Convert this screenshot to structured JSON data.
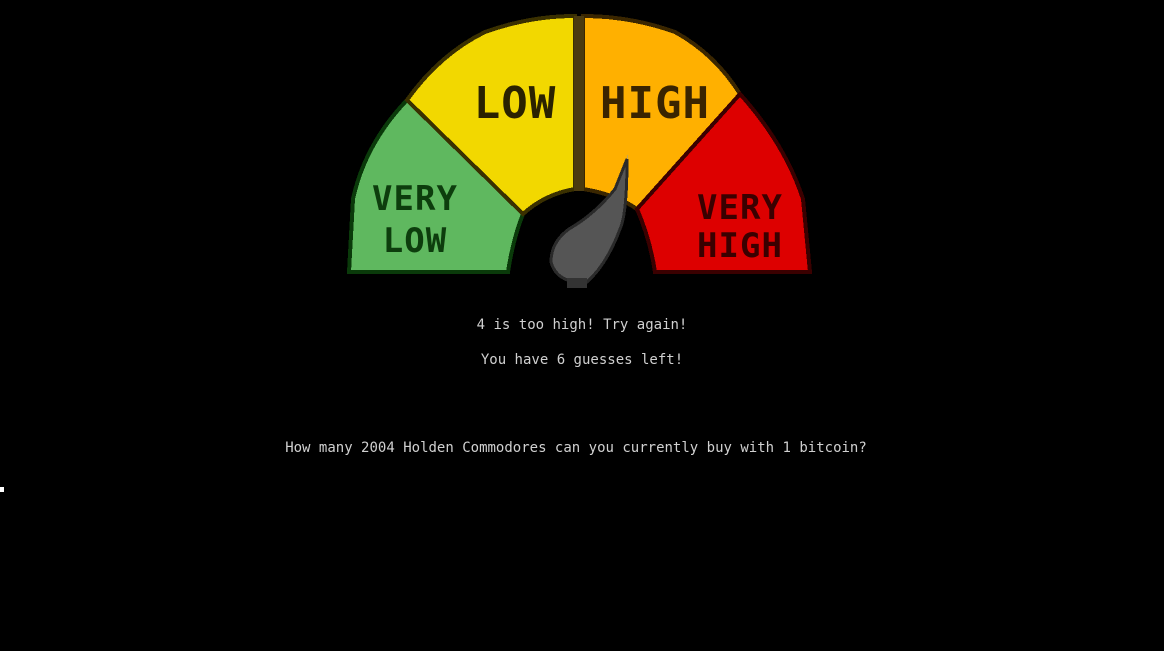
{
  "gauge": {
    "zones": [
      {
        "id": "very-low",
        "line1": "VERY",
        "line2": "LOW",
        "color": "#5fb85f"
      },
      {
        "id": "low",
        "line1": "LOW",
        "line2": "",
        "color": "#f2d800"
      },
      {
        "id": "high",
        "line1": "HIGH",
        "line2": "",
        "color": "#ffb000"
      },
      {
        "id": "very-high",
        "line1": "VERY",
        "line2": "HIGH",
        "color": "#dd0000"
      }
    ],
    "needle_color": "#555555",
    "indicated_zone": "high"
  },
  "feedback": "4 is too high! Try again!",
  "guesses_left": "You have 6 guesses left!",
  "question": "How many 2004 Holden Commodores can you currently buy with 1 bitcoin?"
}
